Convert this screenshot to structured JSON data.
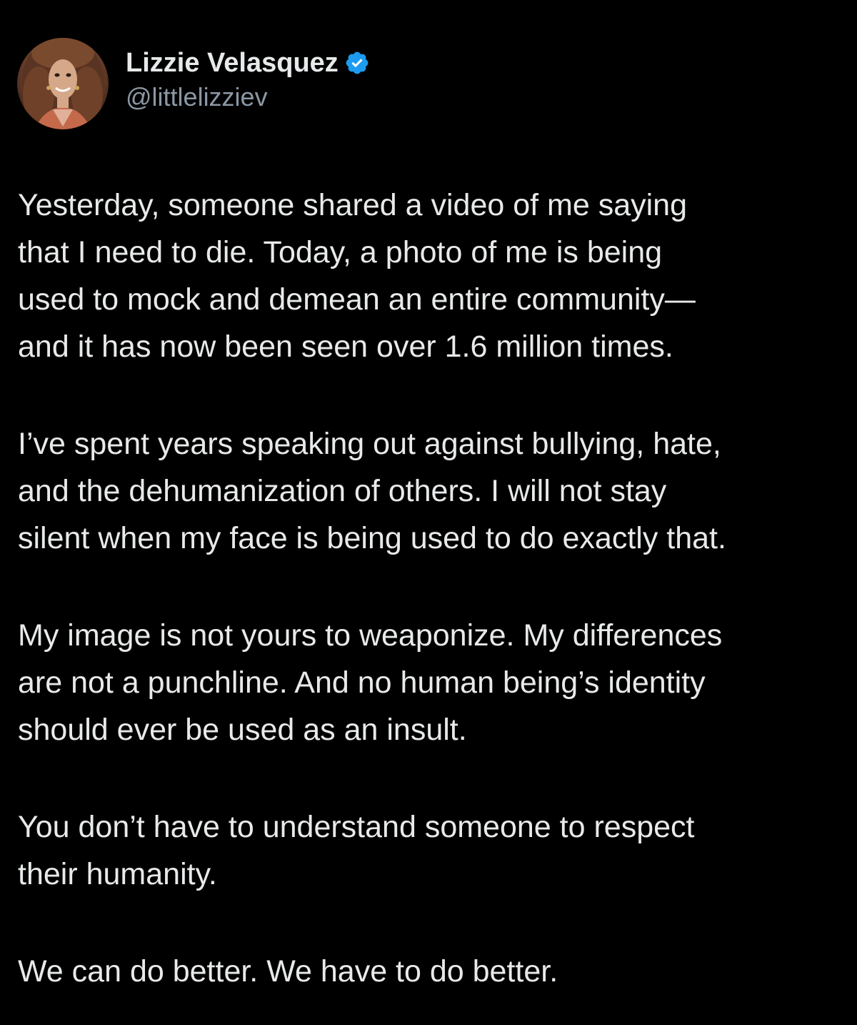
{
  "author": {
    "display_name": "Lizzie Velasquez",
    "handle": "@littlelizziev",
    "verified_icon": "verified-badge-icon",
    "verified_color": "#1d9bf0",
    "avatar_icon": "profile-photo"
  },
  "tweet": {
    "paragraphs": [
      {
        "lines": [
          "Yesterday, someone shared a video of me saying",
          "that I need to die. Today, a photo of me is being",
          "used to mock and demean an entire community—",
          "and it has now been seen over 1.6 million times."
        ]
      },
      {
        "lines": [
          "I’ve spent years speaking out against bullying, hate,",
          "and the dehumanization of others. I will not stay",
          "silent when my face is being used to do exactly that."
        ]
      },
      {
        "lines": [
          "My image is not yours to weaponize. My differences",
          "are not a punchline. And no human being’s identity",
          "should ever be used as an insult."
        ]
      },
      {
        "lines": [
          "You don’t have to understand someone to respect",
          "their humanity."
        ]
      },
      {
        "lines": [
          "We can do better. We have to do better."
        ]
      }
    ]
  },
  "colors": {
    "background": "#000000",
    "text": "#e7e9ea",
    "secondary_text": "#8b98a5"
  }
}
